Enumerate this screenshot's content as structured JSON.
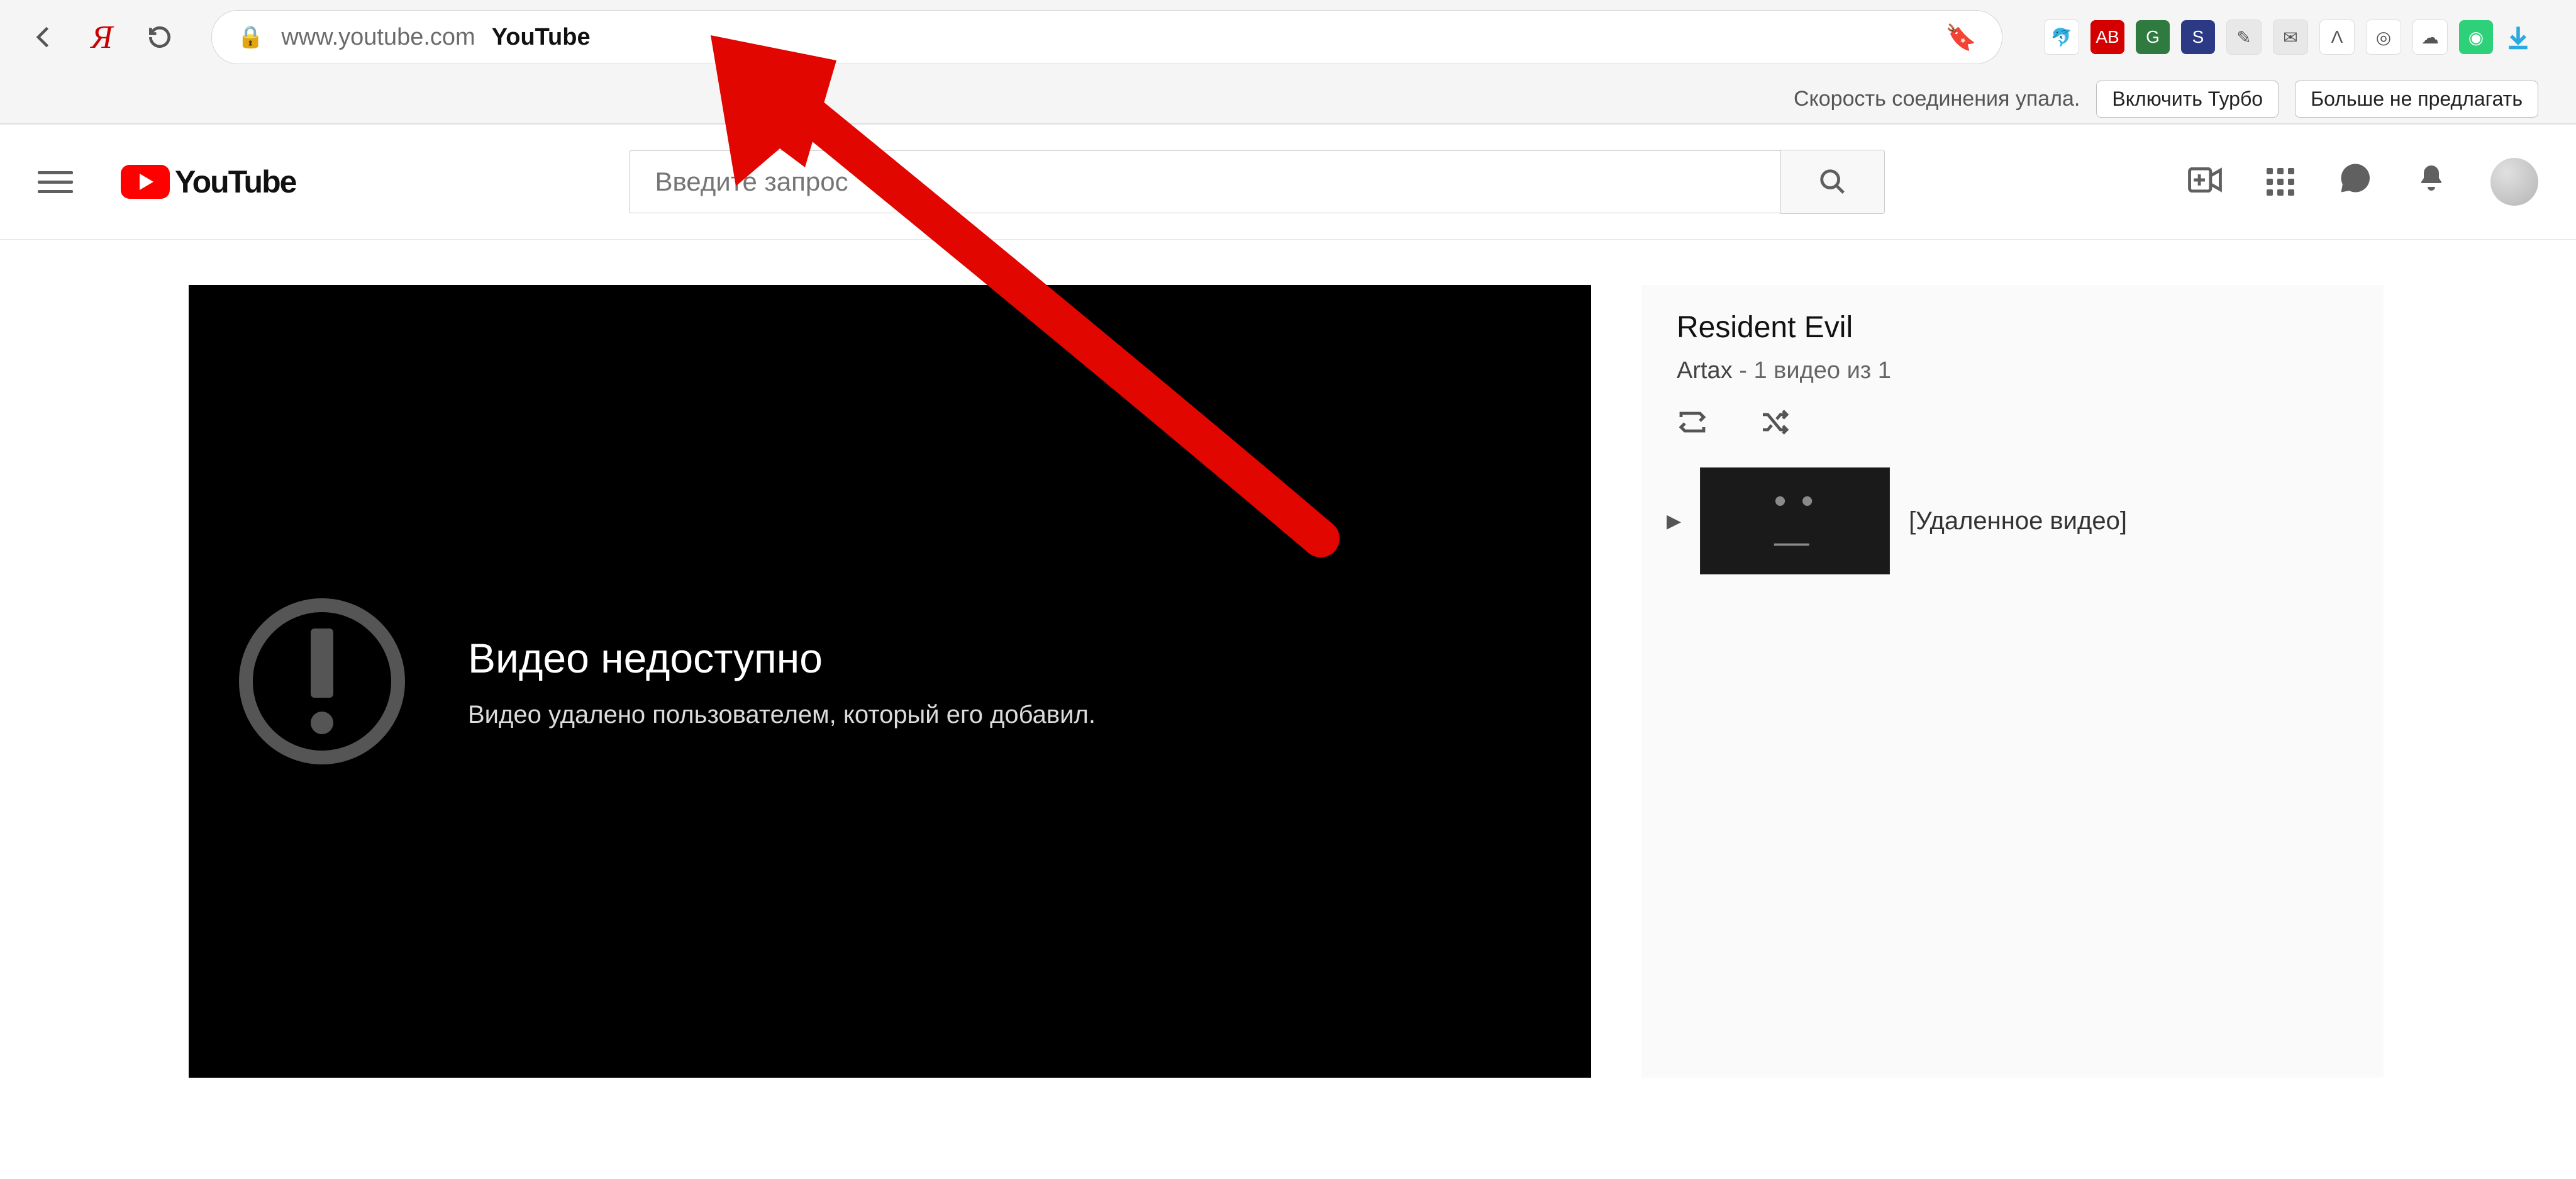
{
  "browser": {
    "url": "www.youtube.com",
    "page_title": "YouTube",
    "extensions": [
      {
        "name": "dolphin-ext-icon",
        "bg": "#ffffff",
        "glyph": "🐬"
      },
      {
        "name": "adblock-ext-icon",
        "bg": "#d40000",
        "glyph": "AB"
      },
      {
        "name": "google-meet-ext-icon",
        "bg": "#2f7a3e",
        "glyph": "G"
      },
      {
        "name": "savefrom-ext-icon",
        "bg": "#2c3a85",
        "glyph": "S"
      },
      {
        "name": "note-ext-icon",
        "bg": "#e8e8e8",
        "glyph": "✎"
      },
      {
        "name": "mail-ext-icon",
        "bg": "#e8e8e8",
        "glyph": "✉"
      },
      {
        "name": "metrika-ext-icon",
        "bg": "#ffffff",
        "glyph": "Λ"
      },
      {
        "name": "instagram-ext-icon",
        "bg": "#ffffff",
        "glyph": "◎"
      },
      {
        "name": "cloud-ext-icon",
        "bg": "#ffffff",
        "glyph": "☁"
      },
      {
        "name": "kiwi-ext-icon",
        "bg": "#2dd17a",
        "glyph": "◉"
      }
    ]
  },
  "turbo": {
    "message": "Скорость соединения упала.",
    "enable_label": "Включить Турбо",
    "dismiss_label": "Больше не предлагать"
  },
  "masthead": {
    "logo_text": "YouTube",
    "search_placeholder": "Введите запрос"
  },
  "player_error": {
    "title": "Видео недоступно",
    "subtitle": "Видео удалено пользователем, который его добавил."
  },
  "playlist": {
    "title": "Resident Evil",
    "author": "Artax",
    "byline_suffix": " - 1 видео из 1",
    "items": [
      {
        "label": "[Удаленное видео]"
      }
    ]
  }
}
